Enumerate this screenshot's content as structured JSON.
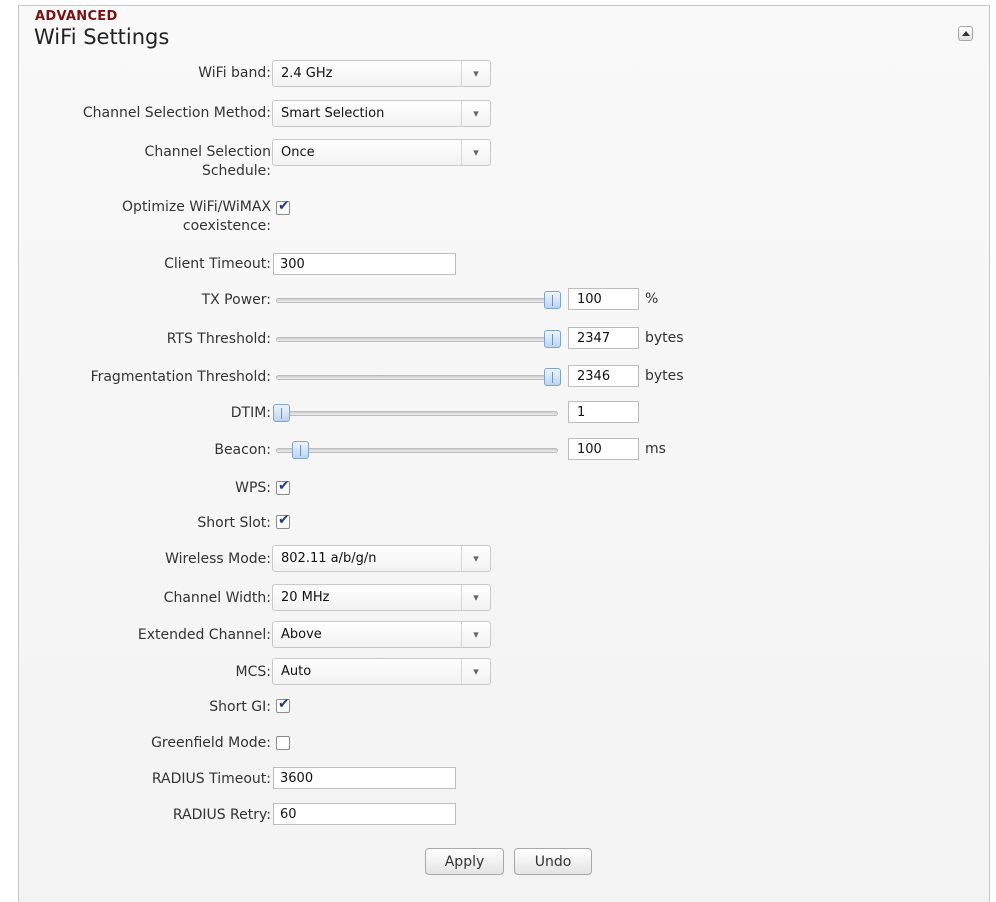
{
  "section": {
    "category": "ADVANCED",
    "title": "WiFi Settings"
  },
  "fields": {
    "wifi_band": {
      "label": "WiFi band:",
      "value": "2.4 GHz"
    },
    "channel_method": {
      "label": "Channel Selection Method:",
      "value": "Smart Selection"
    },
    "channel_schedule": {
      "label_line1": "Channel Selection",
      "label_line2": "Schedule:",
      "value": "Once"
    },
    "optimize": {
      "label_line1": "Optimize WiFi/WiMAX",
      "label_line2": "coexistence:",
      "checked": true
    },
    "client_timeout": {
      "label": "Client Timeout:",
      "value": "300"
    },
    "tx_power": {
      "label": "TX Power:",
      "value": "100",
      "unit": "%",
      "slider_fraction": 1.0
    },
    "rts_threshold": {
      "label": "RTS Threshold:",
      "value": "2347",
      "unit": "bytes",
      "slider_fraction": 1.0
    },
    "frag_threshold": {
      "label": "Fragmentation Threshold:",
      "value": "2346",
      "unit": "bytes",
      "slider_fraction": 1.0
    },
    "dtim": {
      "label": "DTIM:",
      "value": "1",
      "unit": "",
      "slider_fraction": 0.0
    },
    "beacon": {
      "label": "Beacon:",
      "value": "100",
      "unit": "ms",
      "slider_fraction": 0.07
    },
    "wps": {
      "label": "WPS:",
      "checked": true
    },
    "short_slot": {
      "label": "Short Slot:",
      "checked": true
    },
    "wireless_mode": {
      "label": "Wireless Mode:",
      "value": "802.11 a/b/g/n"
    },
    "channel_width": {
      "label": "Channel Width:",
      "value": "20 MHz"
    },
    "extended_channel": {
      "label": "Extended Channel:",
      "value": "Above"
    },
    "mcs": {
      "label": "MCS:",
      "value": "Auto"
    },
    "short_gi": {
      "label": "Short GI:",
      "checked": true
    },
    "greenfield": {
      "label": "Greenfield Mode:",
      "checked": false
    },
    "radius_timeout": {
      "label": "RADIUS Timeout:",
      "value": "3600"
    },
    "radius_retry": {
      "label": "RADIUS Retry:",
      "value": "60"
    }
  },
  "buttons": {
    "apply": "Apply",
    "undo": "Undo"
  },
  "icons": {
    "dropdown": "chevron-down-icon",
    "collapse": "collapse-up-icon",
    "checkmark": "checkmark-icon"
  }
}
